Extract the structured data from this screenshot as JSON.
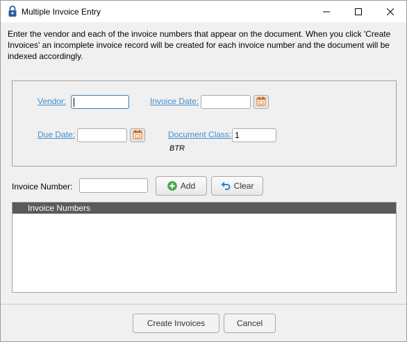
{
  "window": {
    "title": "Multiple Invoice Entry",
    "icon": "lock-icon"
  },
  "intro_text": "Enter the vendor and each of the invoice numbers that appear on the document. When you click 'Create Invoices' an incomplete invoice record will be created for each invoice number and the document will be indexed accordingly.",
  "form": {
    "vendor_label": "Vendor:",
    "vendor_value": "",
    "invoice_date_label": "Invoice Date:",
    "invoice_date_value": "",
    "due_date_label": "Due Date:",
    "due_date_value": "",
    "document_class_label": "Document Class:",
    "document_class_value": "1",
    "document_class_desc": "BTR"
  },
  "invoice_entry": {
    "label": "Invoice Number:",
    "value": "",
    "add_label": "Add",
    "clear_label": "Clear"
  },
  "list": {
    "header": "Invoice Numbers",
    "items": []
  },
  "footer": {
    "create_label": "Create Invoices",
    "cancel_label": "Cancel"
  },
  "colors": {
    "link": "#3d8fd0",
    "calendar_accent": "#e07a3a",
    "add_icon": "#4caf50",
    "clear_icon": "#2f7fd0"
  }
}
